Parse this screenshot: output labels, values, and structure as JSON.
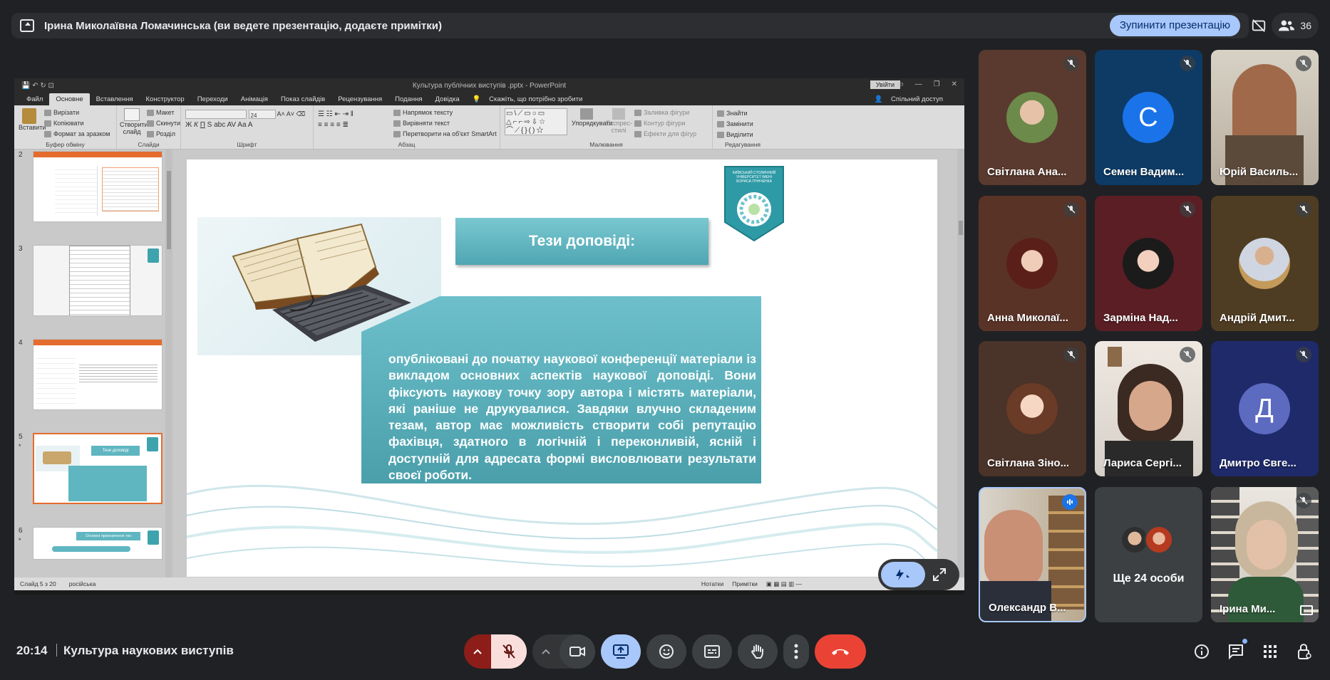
{
  "banner": {
    "text": "Ірина Миколаївна Ломачинська (ви ведете презентацію, додаєте примітки)",
    "stop_button": "Зупинити презентацію",
    "participants_count": "36"
  },
  "ppt": {
    "title": "Культура публічних виступів .pptx  -  PowerPoint",
    "login": "Увійти",
    "tabs": [
      "Файл",
      "Основне",
      "Вставлення",
      "Конструктор",
      "Переходи",
      "Анімація",
      "Показ слайдів",
      "Рецензування",
      "Подання",
      "Довідка"
    ],
    "tell_me": "Скажіть, що потрібно зробити",
    "share": "Спільний доступ",
    "ribbon": {
      "clipboard": {
        "paste": "Вставити",
        "cut": "Вирізати",
        "copy": "Копіювати",
        "format": "Формат за зразком",
        "label": "Буфер обміну"
      },
      "slides": {
        "new": "Створити слайд",
        "layout": "Макет",
        "reset": "Скинути",
        "section": "Розділ",
        "label": "Слайди"
      },
      "font": {
        "size": "24",
        "label": "Шрифт"
      },
      "paragraph": {
        "direction": "Напрямок тексту",
        "align": "Вирівняти текст",
        "smartart": "Перетворити на об'єкт SmartArt",
        "label": "Абзац"
      },
      "drawing": {
        "arrange": "Упорядкувати",
        "quick_styles": "Експрес-стилі",
        "fill": "Заливка фігури",
        "outline": "Контур фігури",
        "effects": "Ефекти для фігур",
        "label": "Малювання"
      },
      "editing": {
        "find": "Знайти",
        "replace": "Замінити",
        "select": "Виділити",
        "label": "Редагування"
      }
    },
    "thumbnails": [
      {
        "num": "2",
        "star": ""
      },
      {
        "num": "3",
        "star": ""
      },
      {
        "num": "4",
        "star": ""
      },
      {
        "num": "5",
        "star": "*"
      },
      {
        "num": "6",
        "star": "*"
      }
    ],
    "thumb5_title": "Тези доповіді",
    "thumb6_title": "Основні призначення тез",
    "slide": {
      "title": "Тези доповіді:",
      "body": "опубліковані до початку наукової конференції матеріали із викладом основних аспектів наукової доповіді. Вони фіксують наукову точку зору автора і містять матеріали, які раніше не друкувалися. Завдяки влучно складеним тезам, автор має можливість створити собі репутацію фахівця, здатного в логічній і переконливій, ясній і доступній для адресата формі висловлювати результати своєї роботи.",
      "logo_text": "КИЇВСЬКИЙ СТОЛИЧНИЙ УНІВЕРСИТЕТ ІМЕНІ БОРИСА ГРІНЧЕНКА"
    },
    "status": {
      "slide": "Слайд 5 з 20",
      "lang": "російська",
      "notes": "Нотатки",
      "comments": "Примітки"
    }
  },
  "participants": [
    {
      "name": "Світлана Ана...",
      "type": "photo",
      "muted": true
    },
    {
      "name": "Семен Вадим...",
      "type": "letter",
      "letter": "С",
      "color": "#1a73e8",
      "muted": true
    },
    {
      "name": "Юрій Василь...",
      "type": "video",
      "muted": true
    },
    {
      "name": "Анна Миколаї...",
      "type": "photo",
      "muted": true
    },
    {
      "name": "Зарміна Над...",
      "type": "photo",
      "muted": true
    },
    {
      "name": "Андрій Дмит...",
      "type": "photo",
      "muted": true
    },
    {
      "name": "Світлана Зіно...",
      "type": "photo",
      "muted": true
    },
    {
      "name": "Лариса Сергі...",
      "type": "video",
      "muted": true
    },
    {
      "name": "Дмитро Євге...",
      "type": "letter",
      "letter": "Д",
      "color": "#5c6bc0",
      "muted": true
    },
    {
      "name": "Олександр В...",
      "type": "video",
      "speaking": true
    },
    {
      "name": "Ще 24 особи",
      "type": "more"
    },
    {
      "name": "Ірина Ми...",
      "type": "video"
    }
  ],
  "bottom": {
    "time": "20:14",
    "meeting_title": "Культура наукових виступів"
  },
  "colors": {
    "accent": "#a8c7fa",
    "end_call": "#ea4335",
    "mic_off": "#f9dedc"
  }
}
